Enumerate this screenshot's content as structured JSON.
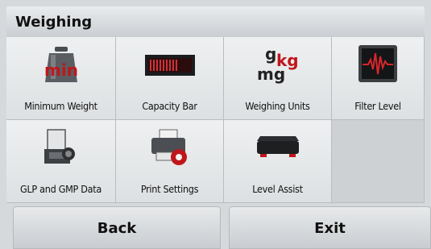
{
  "title": "Weighing",
  "tiles": [
    {
      "label": "Minimum Weight",
      "icon": "minimum-weight-icon"
    },
    {
      "label": "Capacity Bar",
      "icon": "capacity-bar-icon"
    },
    {
      "label": "Weighing Units",
      "icon": "weighing-units-icon"
    },
    {
      "label": "Filter Level",
      "icon": "filter-level-icon"
    },
    {
      "label": "GLP and GMP Data",
      "icon": "glp-gmp-icon"
    },
    {
      "label": "Print Settings",
      "icon": "print-settings-icon"
    },
    {
      "label": "Level Assist",
      "icon": "level-assist-icon"
    }
  ],
  "units_icon_text": {
    "g": "g",
    "kg": "kg",
    "mg": "mg"
  },
  "min_icon_text": "min",
  "buttons": {
    "back": "Back",
    "exit": "Exit"
  },
  "colors": {
    "accent_red": "#c0161b"
  }
}
